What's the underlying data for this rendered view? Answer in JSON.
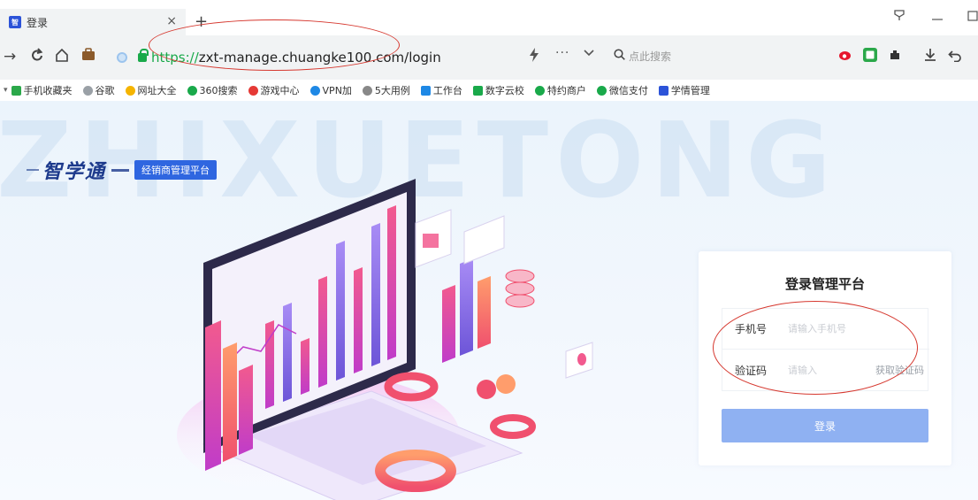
{
  "browser": {
    "tab_title": "登录",
    "tab_favicon": "智",
    "tab_close": "×",
    "new_tab": "+",
    "url_protocol": "https://",
    "url_rest": "zxt-manage.chuangke100.com/login",
    "search_placeholder": "点此搜索",
    "bookmarks": [
      "手机收藏夹",
      "谷歌",
      "网址大全",
      "360搜索",
      "游戏中心",
      "VPN加",
      "5大用例",
      "工作台",
      "数字云校",
      "特约商户",
      "微信支付",
      "学情管理"
    ]
  },
  "page": {
    "watermark": "ZHIXUETONG",
    "brand_name": "智学通",
    "brand_tag": "经销商管理平台",
    "login": {
      "title": "登录管理平台",
      "phone_label": "手机号",
      "phone_placeholder": "请输入手机号",
      "code_label": "验证码",
      "code_placeholder": "请输入",
      "get_code": "获取验证码",
      "submit": "登录"
    }
  },
  "colors": {
    "accent": "#2f66e0",
    "button": "#8fb1f2",
    "annotation": "#d6382f",
    "secure": "#19a94a"
  }
}
